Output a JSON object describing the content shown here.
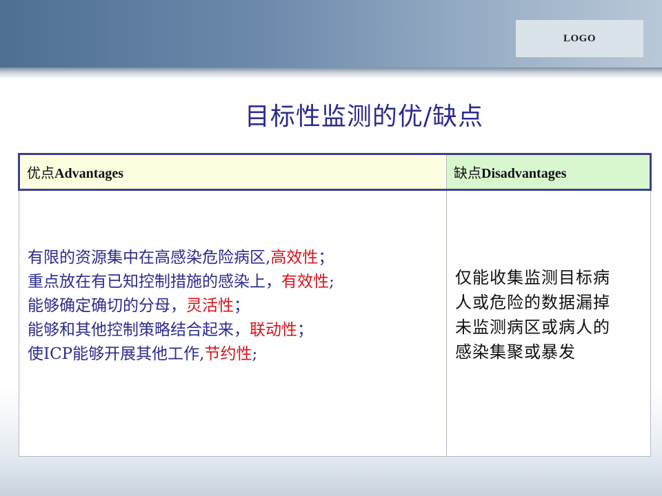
{
  "logo": "LOGO",
  "title": "目标性监测的优/缺点",
  "table": {
    "adv_header_zh": "优点",
    "adv_header_en": "Advantages",
    "dis_header_zh": "缺点",
    "dis_header_en": "Disadvantages",
    "advantages": [
      {
        "text": "有限的资源集中在高感染危险病区,",
        "highlight": "高效性",
        "end": "；"
      },
      {
        "text": "重点放在有已知控制措施的感染上，",
        "highlight": "有效性",
        "end": ";"
      },
      {
        "text": "能够确定确切的分母，",
        "highlight": "灵活性",
        "end": "；"
      },
      {
        "text": "能够和其他控制策略结合起来，",
        "highlight": "联动性",
        "end": "；"
      },
      {
        "text": "使ICP能够开展其他工作,",
        "highlight": "节约性",
        "end": ";"
      }
    ],
    "disadvantages": "仅能收集监测目标病人或危险的数据漏掉未监测病区或病人的感染集聚或暴发"
  }
}
